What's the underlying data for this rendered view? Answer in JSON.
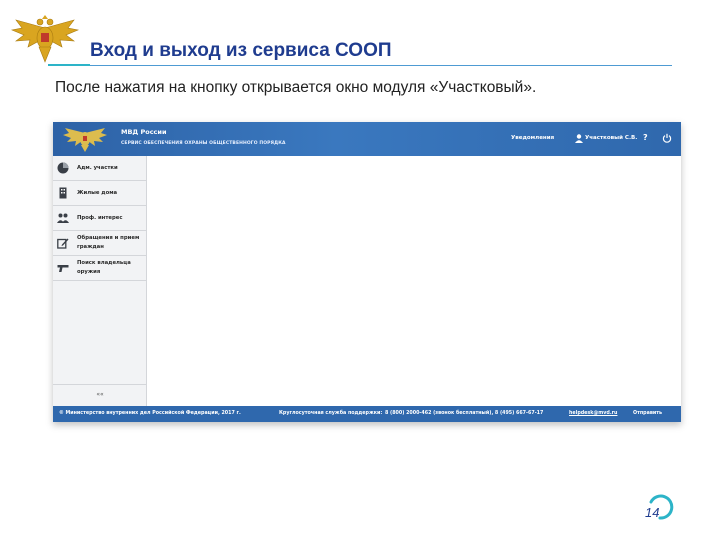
{
  "slide": {
    "title": "Вход и выход из сервиса СООП",
    "subtitle": "После нажатия на кнопку открывается окно модуля «Участковый».",
    "page_number": "14"
  },
  "app": {
    "header": {
      "name": "МВД России",
      "service": "СЕРВИС ОБЕСПЕЧЕНИЯ ОХРАНЫ ОБЩЕСТВЕННОГО ПОРЯДКА",
      "notifications": "Уведомления",
      "user": "Участковый С.В.",
      "help": "?"
    },
    "sidebar": {
      "items": [
        {
          "label": "Адм. участки",
          "icon": "pie-chart-icon"
        },
        {
          "label": "Жилые дома",
          "icon": "building-icon"
        },
        {
          "label": "Проф. интерес",
          "icon": "people-icon"
        },
        {
          "label_line1": "Обращения и прием",
          "label_line2": "граждан",
          "icon": "edit-icon"
        },
        {
          "label_line1": "Поиск владельца",
          "label_line2": "оружия",
          "icon": "gun-icon"
        }
      ],
      "collapse": "««"
    },
    "footer": {
      "copyright": "© Министерство внутренних дел Российской Федерации, 2017 г.",
      "support_label": "Круглосуточная служба поддержки:",
      "phones": "8 (800) 2000-462 (звонок бесплатный), 8 (495) 667-67-17",
      "email": "helpdesk@mvd.ru",
      "send": "Отправить"
    }
  },
  "colors": {
    "title": "#1f3c8f",
    "header_blue": "#2f68ad",
    "accent_teal": "#2db4c8"
  }
}
